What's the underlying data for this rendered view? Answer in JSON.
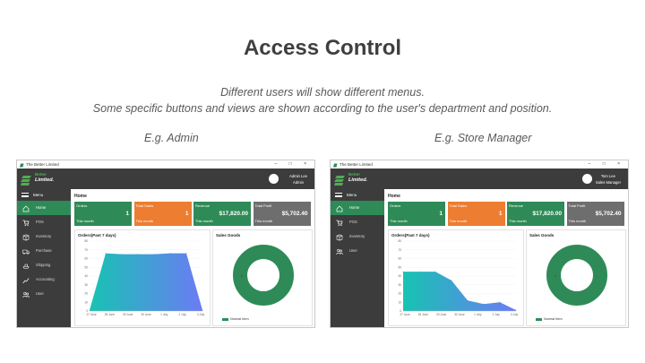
{
  "slide": {
    "title": "Access Control",
    "subtitle_line1": "Different users will show different menus.",
    "subtitle_line2": "Some specific buttons and views are shown according to the user's department and position."
  },
  "colors": {
    "sidebar": "#3c3c3c",
    "nav_active": "#2e8b57",
    "card_orders": "#2e8b57",
    "card_sales": "#ed7d31",
    "card_revenue": "#2e8b57",
    "card_profit": "#6e6e6e",
    "donut": "#2e8b57"
  },
  "left": {
    "caption": "E.g. Admin",
    "window_title": "The Better Limited",
    "window_controls": "– □ ×",
    "company_line1": "Better",
    "company_line2": "Limited.",
    "user_name": "Admin Lee",
    "user_role": "Admin",
    "menu_label": "Menu",
    "nav": [
      {
        "label": "Home",
        "icon": "home-icon"
      },
      {
        "label": "POS",
        "icon": "cart-icon"
      },
      {
        "label": "Inventory",
        "icon": "box-icon"
      },
      {
        "label": "Purchase",
        "icon": "truck-icon"
      },
      {
        "label": "Shipping",
        "icon": "ship-icon"
      },
      {
        "label": "Accounting",
        "icon": "chart-icon"
      },
      {
        "label": "User",
        "icon": "users-icon"
      }
    ],
    "page_title": "Home",
    "cards": [
      {
        "label": "Orders",
        "value": "1",
        "period": "This month"
      },
      {
        "label": "Total Sales",
        "value": "1",
        "period": "This month"
      },
      {
        "label": "Revenue",
        "value": "$17,820.00",
        "period": "This month"
      },
      {
        "label": "Total Profit",
        "value": "$5,702.40",
        "period": "This month"
      }
    ],
    "orders_title": "Orders(Past 7 days)",
    "sales_title": "Sales Goods",
    "donut_label": "1",
    "legend": "Normal Item"
  },
  "right": {
    "caption": "E.g. Store Manager",
    "window_title": "The Better Limited",
    "window_controls": "– □ ×",
    "company_line1": "Better",
    "company_line2": "Limited.",
    "user_name": "Tom Lee",
    "user_role": "Sales Manager",
    "menu_label": "Menu",
    "nav": [
      {
        "label": "Home",
        "icon": "home-icon"
      },
      {
        "label": "POS",
        "icon": "cart-icon"
      },
      {
        "label": "Inventory",
        "icon": "box-icon"
      },
      {
        "label": "User",
        "icon": "users-icon"
      }
    ],
    "page_title": "Home",
    "cards": [
      {
        "label": "Orders",
        "value": "1",
        "period": "This month"
      },
      {
        "label": "Total Sales",
        "value": "1",
        "period": "This month"
      },
      {
        "label": "Revenue",
        "value": "$17,820.00",
        "period": "This month"
      },
      {
        "label": "Total Profit",
        "value": "$5,702.40",
        "period": "This month"
      }
    ],
    "orders_title": "Orders(Past 7 days)",
    "sales_title": "Sales Goods",
    "donut_label": "1",
    "legend": "Normal Item"
  },
  "chart_data": [
    {
      "type": "area",
      "title": "Orders(Past 7 days)",
      "categories": [
        "27 June",
        "28 June",
        "29 June",
        "30 June",
        "1 July",
        "2 July",
        "3 July"
      ],
      "ylim": [
        0,
        80
      ],
      "yticks": [
        0,
        10,
        20,
        30,
        40,
        50,
        60,
        70,
        80
      ],
      "values": [
        1,
        66,
        65,
        65,
        65,
        66,
        66,
        1
      ]
    },
    {
      "type": "area",
      "title": "Orders(Past 7 days)",
      "categories": [
        "27 June",
        "28 June",
        "29 June",
        "30 June",
        "1 July",
        "2 July",
        "3 July"
      ],
      "ylim": [
        0,
        80
      ],
      "yticks": [
        0,
        10,
        20,
        30,
        40,
        50,
        60,
        70,
        80
      ],
      "values": [
        45,
        45,
        45,
        35,
        12,
        8,
        10,
        1
      ]
    }
  ]
}
